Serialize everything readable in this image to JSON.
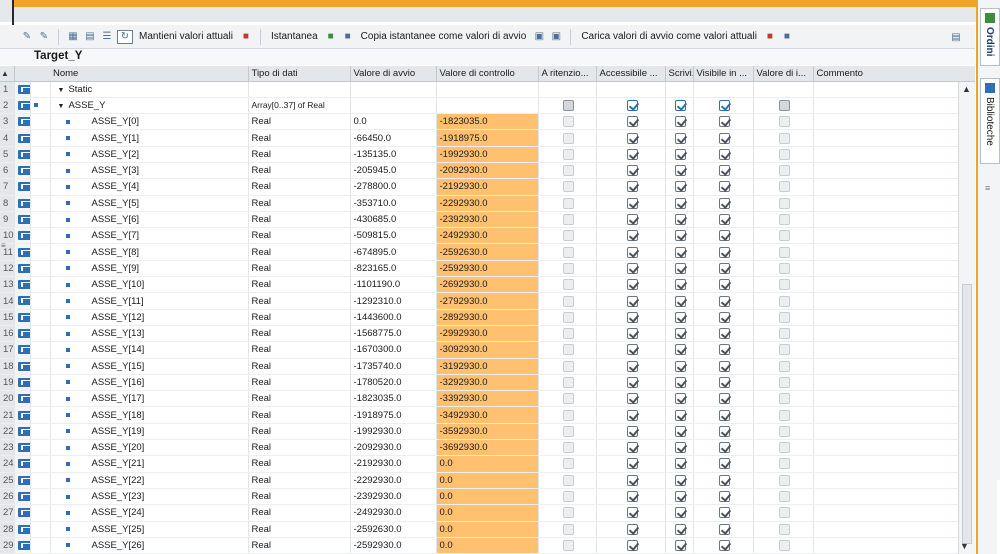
{
  "toolbar": {
    "keep_current_values": "Mantieni valori attuali",
    "snapshot": "Istantanea",
    "copy_snapshots": "Copia istantanee come valori di avvio",
    "load_start_values": "Carica valori di avvio come valori attuali"
  },
  "block_title": "Target_Y",
  "columns": [
    "Nome",
    "Tipo di dati",
    "Valore di avvio",
    "Valore di controllo",
    "A ritenzio...",
    "Accessibile ...",
    "Scrivi...",
    "Visibile in ...",
    "Valore di i...",
    "Commento"
  ],
  "side_tabs": {
    "orders": "Ordini",
    "libraries": "Biblioteche"
  },
  "rows": [
    {
      "num": "1",
      "name": "Static",
      "type": "",
      "start": "",
      "control": "",
      "level": 0,
      "kind": "section"
    },
    {
      "num": "2",
      "name": "ASSE_Y",
      "type": "Array[0..37] of Real",
      "start": "",
      "control": "",
      "level": 1,
      "kind": "array"
    },
    {
      "num": "3",
      "name": "ASSE_Y[0]",
      "type": "Real",
      "start": "0.0",
      "control": "-1823035.0",
      "kind": "elem"
    },
    {
      "num": "4",
      "name": "ASSE_Y[1]",
      "type": "Real",
      "start": "-66450.0",
      "control": "-1918975.0",
      "kind": "elem"
    },
    {
      "num": "5",
      "name": "ASSE_Y[2]",
      "type": "Real",
      "start": "-135135.0",
      "control": "-1992930.0",
      "kind": "elem"
    },
    {
      "num": "6",
      "name": "ASSE_Y[3]",
      "type": "Real",
      "start": "-205945.0",
      "control": "-2092930.0",
      "kind": "elem"
    },
    {
      "num": "7",
      "name": "ASSE_Y[4]",
      "type": "Real",
      "start": "-278800.0",
      "control": "-2192930.0",
      "kind": "elem"
    },
    {
      "num": "8",
      "name": "ASSE_Y[5]",
      "type": "Real",
      "start": "-353710.0",
      "control": "-2292930.0",
      "kind": "elem"
    },
    {
      "num": "9",
      "name": "ASSE_Y[6]",
      "type": "Real",
      "start": "-430685.0",
      "control": "-2392930.0",
      "kind": "elem"
    },
    {
      "num": "10",
      "name": "ASSE_Y[7]",
      "type": "Real",
      "start": "-509815.0",
      "control": "-2492930.0",
      "kind": "elem"
    },
    {
      "num": "11",
      "name": "ASSE_Y[8]",
      "type": "Real",
      "start": "-674895.0",
      "control": "-2592630.0",
      "kind": "elem"
    },
    {
      "num": "12",
      "name": "ASSE_Y[9]",
      "type": "Real",
      "start": "-823165.0",
      "control": "-2592930.0",
      "kind": "elem"
    },
    {
      "num": "13",
      "name": "ASSE_Y[10]",
      "type": "Real",
      "start": "-1101190.0",
      "control": "-2692930.0",
      "kind": "elem"
    },
    {
      "num": "14",
      "name": "ASSE_Y[11]",
      "type": "Real",
      "start": "-1292310.0",
      "control": "-2792930.0",
      "kind": "elem"
    },
    {
      "num": "15",
      "name": "ASSE_Y[12]",
      "type": "Real",
      "start": "-1443600.0",
      "control": "-2892930.0",
      "kind": "elem"
    },
    {
      "num": "16",
      "name": "ASSE_Y[13]",
      "type": "Real",
      "start": "-1568775.0",
      "control": "-2992930.0",
      "kind": "elem"
    },
    {
      "num": "17",
      "name": "ASSE_Y[14]",
      "type": "Real",
      "start": "-1670300.0",
      "control": "-3092930.0",
      "kind": "elem"
    },
    {
      "num": "18",
      "name": "ASSE_Y[15]",
      "type": "Real",
      "start": "-1735740.0",
      "control": "-3192930.0",
      "kind": "elem"
    },
    {
      "num": "19",
      "name": "ASSE_Y[16]",
      "type": "Real",
      "start": "-1780520.0",
      "control": "-3292930.0",
      "kind": "elem"
    },
    {
      "num": "20",
      "name": "ASSE_Y[17]",
      "type": "Real",
      "start": "-1823035.0",
      "control": "-3392930.0",
      "kind": "elem"
    },
    {
      "num": "21",
      "name": "ASSE_Y[18]",
      "type": "Real",
      "start": "-1918975.0",
      "control": "-3492930.0",
      "kind": "elem"
    },
    {
      "num": "22",
      "name": "ASSE_Y[19]",
      "type": "Real",
      "start": "-1992930.0",
      "control": "-3592930.0",
      "kind": "elem"
    },
    {
      "num": "23",
      "name": "ASSE_Y[20]",
      "type": "Real",
      "start": "-2092930.0",
      "control": "-3692930.0",
      "kind": "elem"
    },
    {
      "num": "24",
      "name": "ASSE_Y[21]",
      "type": "Real",
      "start": "-2192930.0",
      "control": "0.0",
      "kind": "elem"
    },
    {
      "num": "25",
      "name": "ASSE_Y[22]",
      "type": "Real",
      "start": "-2292930.0",
      "control": "0.0",
      "kind": "elem"
    },
    {
      "num": "26",
      "name": "ASSE_Y[23]",
      "type": "Real",
      "start": "-2392930.0",
      "control": "0.0",
      "kind": "elem"
    },
    {
      "num": "27",
      "name": "ASSE_Y[24]",
      "type": "Real",
      "start": "-2492930.0",
      "control": "0.0",
      "kind": "elem"
    },
    {
      "num": "28",
      "name": "ASSE_Y[25]",
      "type": "Real",
      "start": "-2592630.0",
      "control": "0.0",
      "kind": "elem"
    },
    {
      "num": "29",
      "name": "ASSE_Y[26]",
      "type": "Real",
      "start": "-2592930.0",
      "control": "0.0",
      "kind": "elem"
    }
  ],
  "colors": {
    "control_bg": "#ffc070",
    "accent": "#f2a12a",
    "interface_icon": "#2f6db5"
  }
}
